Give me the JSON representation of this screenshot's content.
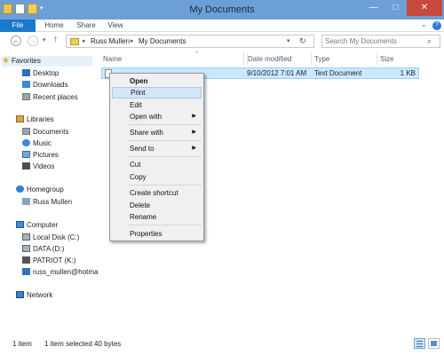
{
  "window": {
    "title": "My Documents",
    "controls": {
      "minimize": "—",
      "maximize": "□",
      "close": "✕"
    }
  },
  "ribbon": {
    "tabs": [
      "File",
      "Home",
      "Share",
      "View"
    ]
  },
  "address": {
    "crumbs": [
      "Russ Mullen",
      "My Documents"
    ],
    "separator": "▸"
  },
  "search": {
    "placeholder": "Search My Documents"
  },
  "nav": {
    "favorites": {
      "label": "Favorites",
      "items": [
        "Desktop",
        "Downloads",
        "Recent places"
      ]
    },
    "libraries": {
      "label": "Libraries",
      "items": [
        "Documents",
        "Music",
        "Pictures",
        "Videos"
      ]
    },
    "homegroup": {
      "label": "Homegroup",
      "items": [
        "Russ Mullen"
      ]
    },
    "computer": {
      "label": "Computer",
      "items": [
        "Local Disk (C:)",
        "DATA (D:)",
        "PATRIOT (K:)",
        "russ_mullen@hotma"
      ]
    },
    "network": {
      "label": "Network"
    }
  },
  "columns": {
    "name": "Name",
    "date": "Date modified",
    "type": "Type",
    "size": "Size"
  },
  "files": [
    {
      "name": "",
      "date": "9/10/2012 7:01 AM",
      "type": "Text Document",
      "size": "1 KB"
    }
  ],
  "context_menu": {
    "items": [
      "Open",
      "Print",
      "Edit",
      "Open with",
      "Share with",
      "Send to",
      "Cut",
      "Copy",
      "Create shortcut",
      "Delete",
      "Rename",
      "Properties"
    ],
    "highlighted": "Print"
  },
  "status": {
    "count": "1 item",
    "selected": "1 item selected  40 bytes"
  },
  "colors": {
    "titlebar": "#6b9fd6",
    "file_tab": "#1979ca",
    "close_button": "#c7493b",
    "selection": "#cce8ff",
    "menu_highlight": "#d5e6f8"
  },
  "icons": {
    "favorites": "star-icon",
    "desktop": "desktop-icon",
    "downloads": "downloads-icon",
    "recent": "recent-places-icon",
    "libraries": "libraries-icon",
    "music": "music-icon",
    "pictures": "pictures-icon",
    "videos": "videos-icon",
    "homegroup": "homegroup-icon",
    "computer": "computer-icon",
    "network": "network-icon"
  }
}
